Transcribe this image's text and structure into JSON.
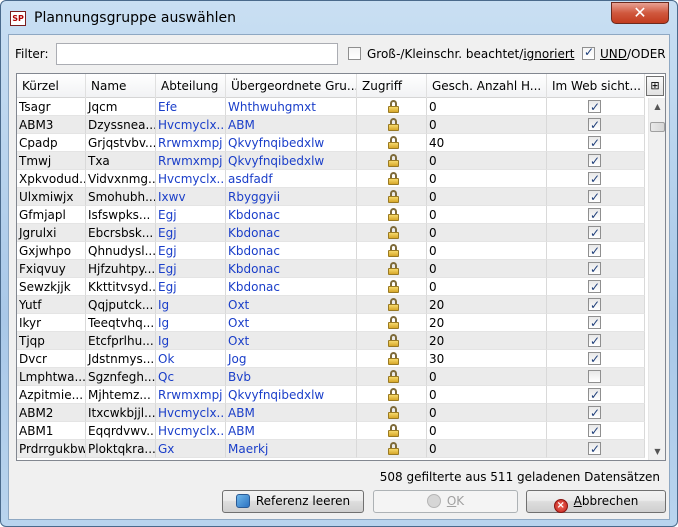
{
  "window": {
    "app_icon": "SP",
    "title": "Plannungsgruppe auswählen",
    "close_glyph": "✕"
  },
  "filter": {
    "label": "Filter:",
    "value": "",
    "case_label_a": "Groß-/Kleinschr. beachtet/",
    "case_label_b": "ignoriert",
    "case_checked": false,
    "logic_label_a": "UND",
    "logic_label_b": "/ODER",
    "logic_checked": true
  },
  "table": {
    "columns": [
      "Kürzel",
      "Name",
      "Abteilung",
      "Übergeordnete Gru...",
      "Zugriff",
      "Gesch. Anzahl H...",
      "Im Web sicht..."
    ],
    "corner_icon": "column-chooser-icon",
    "rows": [
      {
        "kuerzel": "Tsagr",
        "name": "Jqcm",
        "abteilung": "Efe",
        "parent": "Whthwuhgmxt",
        "count": "0",
        "web": true
      },
      {
        "kuerzel": "ABM3",
        "name": "Dzyssnea...",
        "abteilung": "Hvcmyclx...",
        "parent": "ABM",
        "count": "0",
        "web": true
      },
      {
        "kuerzel": "Cpadp",
        "name": "Grjqstvbv...",
        "abteilung": "Rrwmxmpj",
        "parent": "Qkvyfnqibedxlw",
        "count": "40",
        "web": true
      },
      {
        "kuerzel": "Tmwj",
        "name": "Txa",
        "abteilung": "Rrwmxmpj",
        "parent": "Qkvyfnqibedxlw",
        "count": "0",
        "web": true
      },
      {
        "kuerzel": "Xpkvodud...",
        "name": "Vidvxnmg...",
        "abteilung": "Hvcmyclx...",
        "parent": "asdfadf",
        "count": "0",
        "web": true
      },
      {
        "kuerzel": "Ulxmiwjx",
        "name": "Smohubh...",
        "abteilung": "Ixwv",
        "parent": "Rbyggyii",
        "count": "0",
        "web": true
      },
      {
        "kuerzel": "Gfmjapl",
        "name": "Isfswpks...",
        "abteilung": "Egj",
        "parent": "Kbdonac",
        "count": "0",
        "web": true
      },
      {
        "kuerzel": "Jgrulxi",
        "name": "Ebcrsbsk...",
        "abteilung": "Egj",
        "parent": "Kbdonac",
        "count": "0",
        "web": true
      },
      {
        "kuerzel": "Gxjwhpo",
        "name": "Qhnudysl...",
        "abteilung": "Egj",
        "parent": "Kbdonac",
        "count": "0",
        "web": true
      },
      {
        "kuerzel": "Fxiqvuy",
        "name": "Hjfzuhtpy...",
        "abteilung": "Egj",
        "parent": "Kbdonac",
        "count": "0",
        "web": true
      },
      {
        "kuerzel": "Sewzkjjk",
        "name": "Kkttitvsyd...",
        "abteilung": "Egj",
        "parent": "Kbdonac",
        "count": "0",
        "web": true
      },
      {
        "kuerzel": "Yutf",
        "name": "Qqjputck...",
        "abteilung": "Ig",
        "parent": "Oxt",
        "count": "20",
        "web": true
      },
      {
        "kuerzel": "Ikyr",
        "name": "Teeqtvhq...",
        "abteilung": "Ig",
        "parent": "Oxt",
        "count": "20",
        "web": true
      },
      {
        "kuerzel": "Tjqp",
        "name": "Etcfprlhu...",
        "abteilung": "Ig",
        "parent": "Oxt",
        "count": "20",
        "web": true
      },
      {
        "kuerzel": "Dvcr",
        "name": "Jdstnmys...",
        "abteilung": "Ok",
        "parent": "Jog",
        "count": "30",
        "web": true
      },
      {
        "kuerzel": "Lmphtwa...",
        "name": "Sgznfegh...",
        "abteilung": "Qc",
        "parent": "Bvb",
        "count": "0",
        "web": false
      },
      {
        "kuerzel": "Azpitmie...",
        "name": "Mjhtemz...",
        "abteilung": "Rrwmxmpj",
        "parent": "Qkvyfnqibedxlw",
        "count": "0",
        "web": true
      },
      {
        "kuerzel": "ABM2",
        "name": "Itxcwkbjjl...",
        "abteilung": "Hvcmyclx...",
        "parent": "ABM",
        "count": "0",
        "web": true
      },
      {
        "kuerzel": "ABM1",
        "name": "Eqqrdvwv...",
        "abteilung": "Hvcmyclx...",
        "parent": "ABM",
        "count": "0",
        "web": true
      },
      {
        "kuerzel": "Prdrrgukbw",
        "name": "Ploktqkra...",
        "abteilung": "Gx",
        "parent": "Maerkj",
        "count": "0",
        "web": true
      }
    ]
  },
  "status": "508 gefilterte aus 511 geladenen Datensätzen",
  "buttons": {
    "reset": "Referenz leeren",
    "ok_u": "O",
    "ok_rest": "K",
    "cancel_u": "A",
    "cancel_rest": "bbrechen"
  },
  "colors": {
    "link_blue": "#1a3ec9",
    "close_red": "#c23b1e"
  }
}
